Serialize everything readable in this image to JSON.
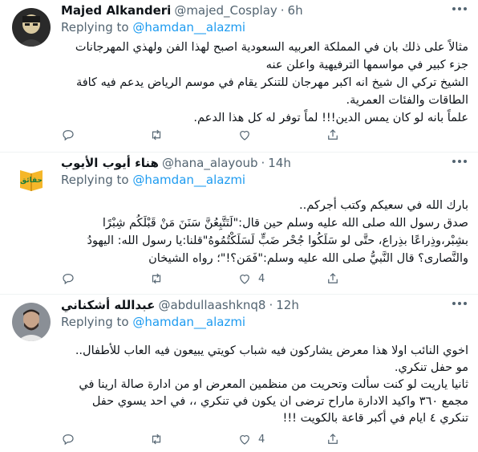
{
  "tweets": [
    {
      "display_name": "Majed Alkanderi",
      "handle": "@majed_Cosplay",
      "separator": "·",
      "time": "6h",
      "replying_to_label": "Replying to",
      "replying_to_handle": "@hamdan__alazmi",
      "text": "مثالاً على ذلك بان في المملكة العربيه السعودية اصبح لهذا الفن ولهذي المهرجانات جزء كبير في مواسمها الترفيهية واعلن عنه\nالشيخ تركي ال شيخ انه اكبر مهرجان للتنكر يقام في موسم الرياض يدعم فيه كافة الطاقات والفئات العمرية.\nعلماً بانه لو كان يمس الدين!!!  لماً توفر له كل هذا الدعم.",
      "counts": {
        "reply": "",
        "retweet": "",
        "like": ""
      }
    },
    {
      "display_name": "هناء أيوب الأيوب",
      "handle": "@hana_alayoub",
      "separator": "·",
      "time": "14h",
      "replying_to_label": "Replying to",
      "replying_to_handle": "@hamdan__alazmi",
      "avatar_text": "حقائق",
      "text": "بارك الله في سعيكم وكتب أجركم..\nصدق رسول الله صلى الله عليه وسلم حين قال:\"لَتَتَّبِعُنَّ سَنَنَ مَنْ قَبْلَكُم شِبْرًا بشِبْر،وذِراعًا بذِراع، حتَّى لو سَلَكُوا جُحْر ضَبٍّ لَسَلَكْتُمُوهُ\"قلنا:يا رسول الله: اليهودُ والنَّصارى؟ قال النَّبيُّ صلى الله عليه وسلم:\"فَمَن؟!\"؛ رواه الشيخان",
      "counts": {
        "reply": "",
        "retweet": "",
        "like": "4"
      }
    },
    {
      "display_name": "عبدالله أشكناني",
      "handle": "@abdullaashknq8",
      "separator": "·",
      "time": "12h",
      "replying_to_label": "Replying to",
      "replying_to_handle": "@hamdan__alazmi",
      "text": "اخوي النائب اولا هذا معرض يشاركون فيه شباب كويتي يبيعون فيه العاب للأطفال.. مو حفل تنكري.\nثانيا ياريت لو كنت سألت وتحريت من منظمين المعرض او من ادارة صالة ارينا في مجمع ٣٦٠ واكيد الادارة ماراح ترضى ان يكون في تنكري ،، في احد يسوي حفل تنكري ٤ ايام في أكبر قاعة بالكويت !!!",
      "counts": {
        "reply": "",
        "retweet": "",
        "like": "4"
      }
    }
  ],
  "colors": {
    "accent": "#1d9bf0",
    "secondary_text": "#536471",
    "primary_text": "#0f1419",
    "avatar_2_bg": "#f5b72a"
  },
  "icons": [
    "more-icon",
    "reply-icon",
    "retweet-icon",
    "like-icon",
    "share-icon"
  ]
}
